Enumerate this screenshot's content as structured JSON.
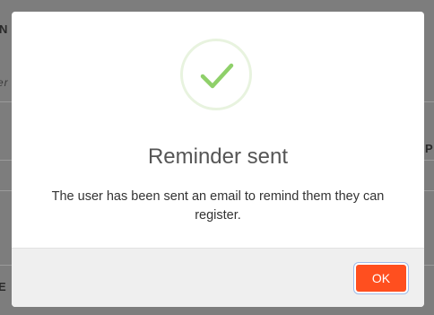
{
  "background": {
    "fragments": [
      "N",
      "er n",
      "P",
      "E N"
    ]
  },
  "dialog": {
    "icon": "checkmark-icon",
    "title": "Reminder sent",
    "message": "The user has been sent an email to remind them they can register.",
    "ok_label": "OK"
  },
  "colors": {
    "accent": "#ff4f1f",
    "check": "#8fd06a",
    "check_ring": "#e8f3df",
    "overlay": "#7d7d7d",
    "footer": "#efefef"
  }
}
